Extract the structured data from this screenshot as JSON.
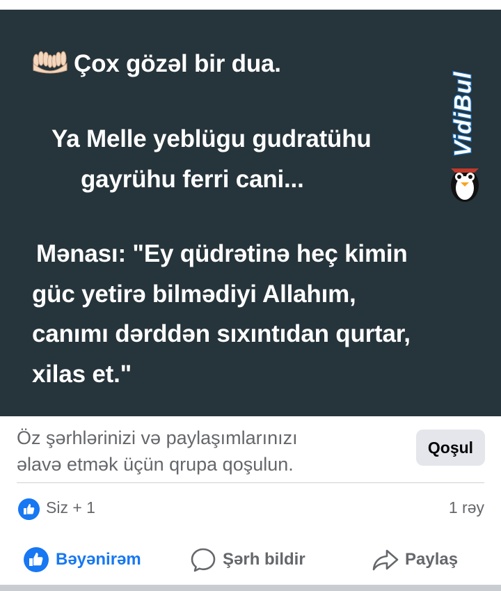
{
  "post": {
    "line1": "Çox gözəl bir dua.",
    "line2": "Ya Melle yeblügu gudratühu",
    "line3": "gayrühu ferri cani...",
    "line4": "Mənası: \"Ey qüdrətinə heç kimin",
    "line5": "güc yetirə bilmədiyi Allahım,",
    "line6": "canımı dərddən sıxıntıdan qurtar,",
    "line7": "xilas et.\"",
    "emoji": "palms-up-together-icon",
    "watermark": "VidiBul",
    "colors": {
      "background": "#26343b",
      "text": "#ffffff",
      "watermark_outline": "#1566ad"
    }
  },
  "join": {
    "text_line1": "Öz şərhlərinizi və paylaşımlarınızı",
    "text_line2": "əlavə etmək üçün qrupa qoşulun.",
    "button": "Qoşul"
  },
  "stats": {
    "reactors": "Siz + 1",
    "comments": "1 rəy"
  },
  "actions": {
    "like": "Bəyənirəm",
    "comment": "Şərh bildir",
    "share": "Paylaş"
  },
  "colors": {
    "accent": "#1877f2",
    "muted": "#65676b"
  }
}
